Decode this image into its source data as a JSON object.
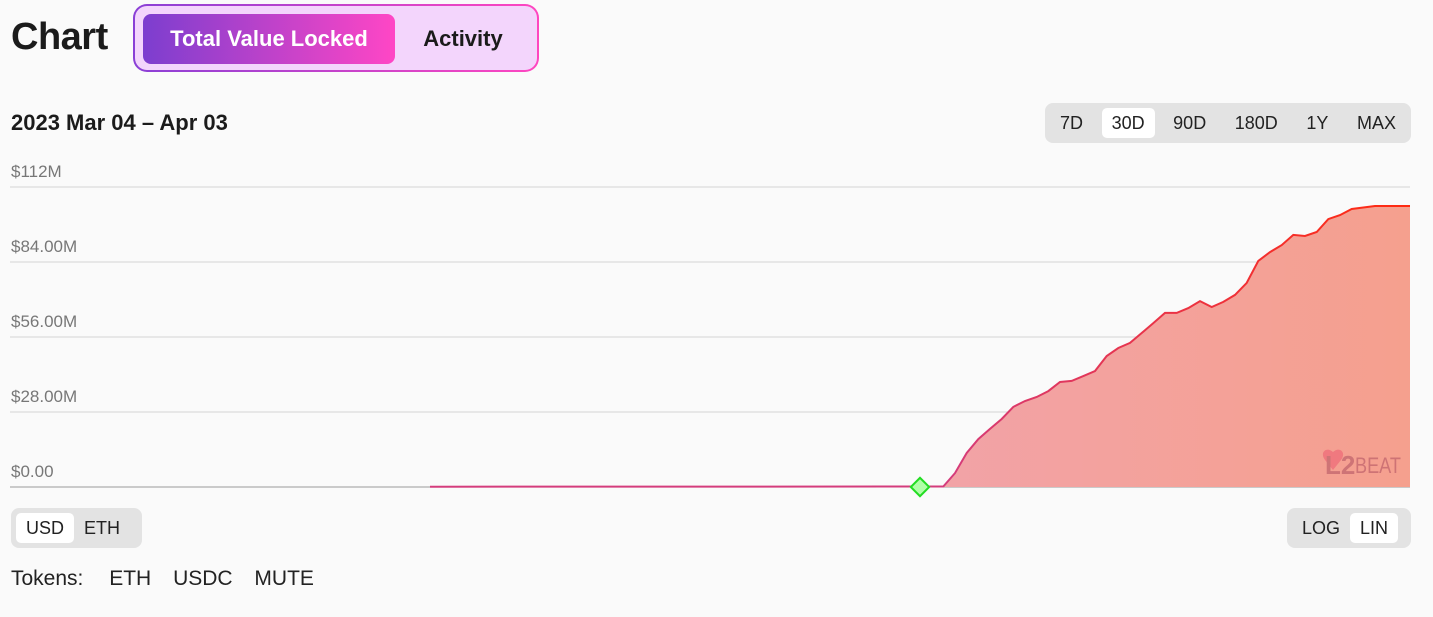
{
  "header": {
    "title": "Chart",
    "tabs": [
      {
        "label": "Total Value Locked",
        "active": true
      },
      {
        "label": "Activity",
        "active": false
      }
    ]
  },
  "date_range": "2023 Mar 04 – Apr 03",
  "range_buttons": [
    {
      "label": "7D"
    },
    {
      "label": "30D",
      "selected": true
    },
    {
      "label": "90D"
    },
    {
      "label": "180D"
    },
    {
      "label": "1Y"
    },
    {
      "label": "MAX"
    }
  ],
  "currency_buttons": [
    {
      "label": "USD",
      "selected": true
    },
    {
      "label": "ETH"
    }
  ],
  "scale_buttons": [
    {
      "label": "LOG"
    },
    {
      "label": "LIN",
      "selected": true
    }
  ],
  "tokens": {
    "label": "Tokens:",
    "items": [
      "ETH",
      "USDC",
      "MUTE"
    ]
  },
  "watermark": "L2BEAT",
  "colors": {
    "line_start": "#d43c7c",
    "line_end": "#ff2a10",
    "fill_start": "#efa6c2",
    "fill_end": "#f5a08e",
    "marker": "#22dd22",
    "marker_fill": "#b0ffa8"
  },
  "chart_data": {
    "type": "area",
    "title": "",
    "xlabel": "",
    "ylabel": "",
    "x_range": [
      "2023-03-04T00:00",
      "2023-04-03T00:00"
    ],
    "ylim": [
      0,
      112
    ],
    "unit": "$M",
    "y_ticks": [
      "$0.00",
      "$28.00M",
      "$56.00M",
      "$84.00M",
      "$112M"
    ],
    "y_tick_values": [
      0,
      28,
      56,
      84,
      112
    ],
    "grid": true,
    "scale": "linear",
    "marker": {
      "x": "2023-03-23T12:00",
      "y": 0
    },
    "x": [
      "2023-03-13T00:00",
      "2023-03-24T00:00",
      "2023-03-24T06:00",
      "2023-03-24T12:00",
      "2023-03-24T18:00",
      "2023-03-25T00:00",
      "2023-03-25T06:00",
      "2023-03-25T12:00",
      "2023-03-25T18:00",
      "2023-03-26T00:00",
      "2023-03-26T06:00",
      "2023-03-26T12:00",
      "2023-03-26T18:00",
      "2023-03-27T00:00",
      "2023-03-27T06:00",
      "2023-03-27T12:00",
      "2023-03-27T18:00",
      "2023-03-28T00:00",
      "2023-03-28T06:00",
      "2023-03-28T12:00",
      "2023-03-28T18:00",
      "2023-03-29T00:00",
      "2023-03-29T06:00",
      "2023-03-29T12:00",
      "2023-03-29T18:00",
      "2023-03-30T00:00",
      "2023-03-30T06:00",
      "2023-03-30T12:00",
      "2023-03-30T18:00",
      "2023-03-31T00:00",
      "2023-03-31T06:00",
      "2023-03-31T12:00",
      "2023-03-31T18:00",
      "2023-04-01T00:00",
      "2023-04-01T06:00",
      "2023-04-01T12:00",
      "2023-04-01T18:00",
      "2023-04-02T06:00",
      "2023-04-03T00:00"
    ],
    "values": [
      0.1,
      0.2,
      5.2,
      12.7,
      17.9,
      21.7,
      25.4,
      29.9,
      32.1,
      33.6,
      35.8,
      39.2,
      39.6,
      41.4,
      43.3,
      48.9,
      51.9,
      53.8,
      57.5,
      61.2,
      65.0,
      65.0,
      66.8,
      69.4,
      67.2,
      69.1,
      71.7,
      76.2,
      84.4,
      87.7,
      90.3,
      94.1,
      93.7,
      95.2,
      100.0,
      101.5,
      103.8,
      104.9,
      104.9
    ]
  }
}
